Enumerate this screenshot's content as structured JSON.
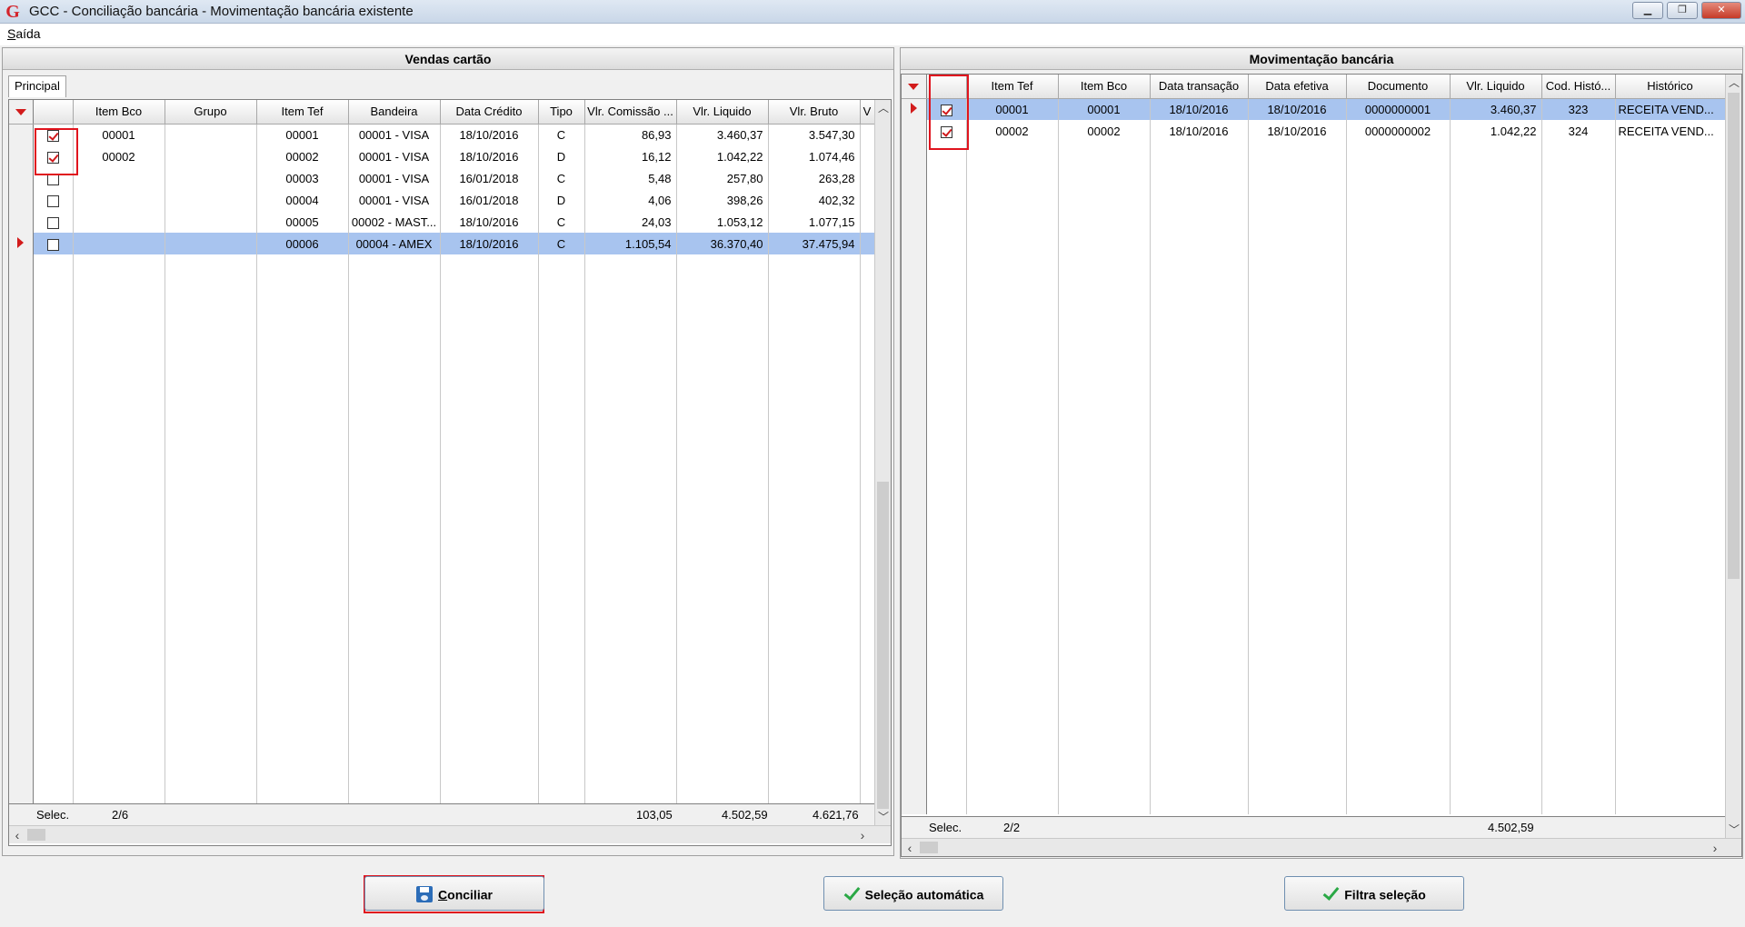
{
  "window": {
    "title": "GCC - Conciliação bancária - Movimentação bancária existente",
    "minimize": "▁",
    "restore": "❐",
    "close": "✕"
  },
  "menu": {
    "saida_first": "S",
    "saida_rest": "aída"
  },
  "left": {
    "title": "Vendas cartão",
    "tab": "Principal",
    "columns": [
      "Item Bco",
      "Grupo",
      "Item Tef",
      "Bandeira",
      "Data Crédito",
      "Tipo",
      "Vlr. Comissão ...",
      "Vlr. Liquido",
      "Vlr. Bruto",
      "V"
    ],
    "rows": [
      {
        "checked": true,
        "item_bco": "00001",
        "grupo": "",
        "item_tef": "00001",
        "bandeira": "00001 - VISA",
        "data": "18/10/2016",
        "tipo": "C",
        "comissao": "86,93",
        "liquido": "3.460,37",
        "bruto": "3.547,30"
      },
      {
        "checked": true,
        "item_bco": "00002",
        "grupo": "",
        "item_tef": "00002",
        "bandeira": "00001 - VISA",
        "data": "18/10/2016",
        "tipo": "D",
        "comissao": "16,12",
        "liquido": "1.042,22",
        "bruto": "1.074,46"
      },
      {
        "checked": false,
        "item_bco": "",
        "grupo": "",
        "item_tef": "00003",
        "bandeira": "00001 - VISA",
        "data": "16/01/2018",
        "tipo": "C",
        "comissao": "5,48",
        "liquido": "257,80",
        "bruto": "263,28"
      },
      {
        "checked": false,
        "item_bco": "",
        "grupo": "",
        "item_tef": "00004",
        "bandeira": "00001 - VISA",
        "data": "16/01/2018",
        "tipo": "D",
        "comissao": "4,06",
        "liquido": "398,26",
        "bruto": "402,32"
      },
      {
        "checked": false,
        "item_bco": "",
        "grupo": "",
        "item_tef": "00005",
        "bandeira": "00002 - MAST...",
        "data": "18/10/2016",
        "tipo": "C",
        "comissao": "24,03",
        "liquido": "1.053,12",
        "bruto": "1.077,15"
      },
      {
        "checked": false,
        "item_bco": "",
        "grupo": "",
        "item_tef": "00006",
        "bandeira": "00004 - AMEX",
        "data": "18/10/2016",
        "tipo": "C",
        "comissao": "1.105,54",
        "liquido": "36.370,40",
        "bruto": "37.475,94",
        "current": true
      }
    ],
    "footer": {
      "label": "Selec.",
      "count": "2/6",
      "comissao": "103,05",
      "liquido": "4.502,59",
      "bruto": "4.621,76"
    }
  },
  "right": {
    "title": "Movimentação bancária",
    "columns": [
      "Item Tef",
      "Item Bco",
      "Data transação",
      "Data efetiva",
      "Documento",
      "Vlr. Liquido",
      "Cod. Histó...",
      "Histórico"
    ],
    "rows": [
      {
        "checked": true,
        "item_tef": "00001",
        "item_bco": "00001",
        "data_transacao": "18/10/2016",
        "data_efetiva": "18/10/2016",
        "documento": "0000000001",
        "liquido": "3.460,37",
        "cod": "323",
        "historico": "RECEITA VEND...",
        "current": true
      },
      {
        "checked": true,
        "item_tef": "00002",
        "item_bco": "00002",
        "data_transacao": "18/10/2016",
        "data_efetiva": "18/10/2016",
        "documento": "0000000002",
        "liquido": "1.042,22",
        "cod": "324",
        "historico": "RECEITA VEND..."
      }
    ],
    "footer": {
      "label": "Selec.",
      "count": "2/2",
      "liquido": "4.502,59"
    }
  },
  "buttons": {
    "conciliar_first": "C",
    "conciliar_rest": "onciliar",
    "selecao": "Seleção automática",
    "filtra": "Filtra seleção"
  },
  "colors": {
    "highlight": "#e0141e",
    "selection": "#a8c4ef",
    "check": "#d0191b"
  }
}
